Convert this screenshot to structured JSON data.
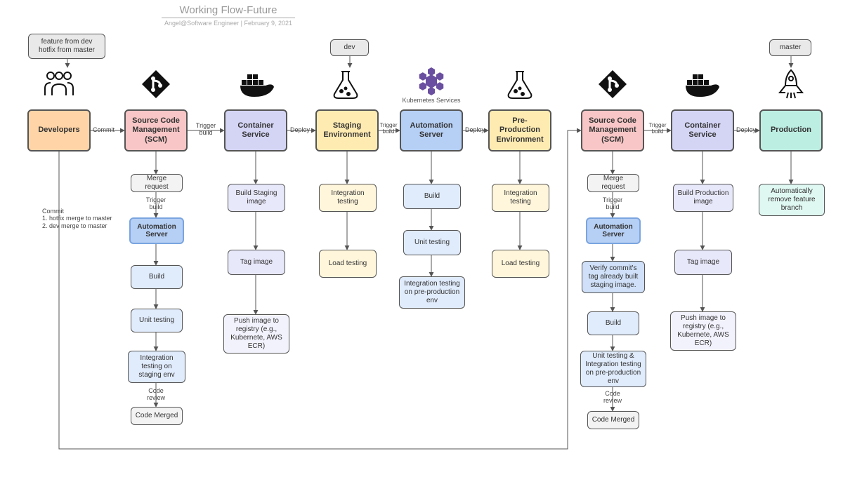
{
  "title": "Working Flow-Future",
  "subtitle": "Angel@Software Engineer  |  February 9, 2021",
  "tags": {
    "feature": "feature from dev\nhotfix from master",
    "dev": "dev",
    "master": "master"
  },
  "kube_caption": "Kubernetes Services",
  "cols": {
    "c1": {
      "main": "Developers"
    },
    "c2": {
      "main": "Source Code Management (SCM)",
      "steps": [
        "Merge request",
        "Build",
        "Unit testing",
        "Integration testing on staging env",
        "Code Merged"
      ],
      "sub": "Automation Server"
    },
    "c3": {
      "main": "Container Service",
      "steps": [
        "Build Staging image",
        "Tag image",
        "Push image to registry (e.g., Kubernete, AWS ECR)"
      ]
    },
    "c4": {
      "main": "Staging Environment",
      "steps": [
        "Integration testing",
        "Load testing"
      ]
    },
    "c5": {
      "main": "Automation Server",
      "steps": [
        "Build",
        "Unit testing",
        "Integration testing on pre-production env"
      ]
    },
    "c6": {
      "main": "Pre-Production Environment",
      "steps": [
        "Integration testing",
        "Load testing"
      ]
    },
    "c7": {
      "main": "Source Code Management (SCM)",
      "steps": [
        "Merge request",
        "Verify commit's tag already built staging image.",
        "Build",
        "Unit testing & Integration testing on pre-production env",
        "Code Merged"
      ],
      "sub": "Automation Server"
    },
    "c8": {
      "main": "Container Service",
      "steps": [
        "Build Production image",
        "Tag image",
        "Push image to registry (e.g., Kubernete, AWS ECR)"
      ]
    },
    "c9": {
      "main": "Production",
      "steps": [
        "Automatically remove feature branch"
      ]
    }
  },
  "edges": {
    "commit": "Commit",
    "trigger": "Trigger\nbuild",
    "deploy": "Deploy",
    "codeReview": "Code\nreview",
    "longCommit": "Commit\n1. hotfix merge to master\n2. dev merge to master"
  }
}
